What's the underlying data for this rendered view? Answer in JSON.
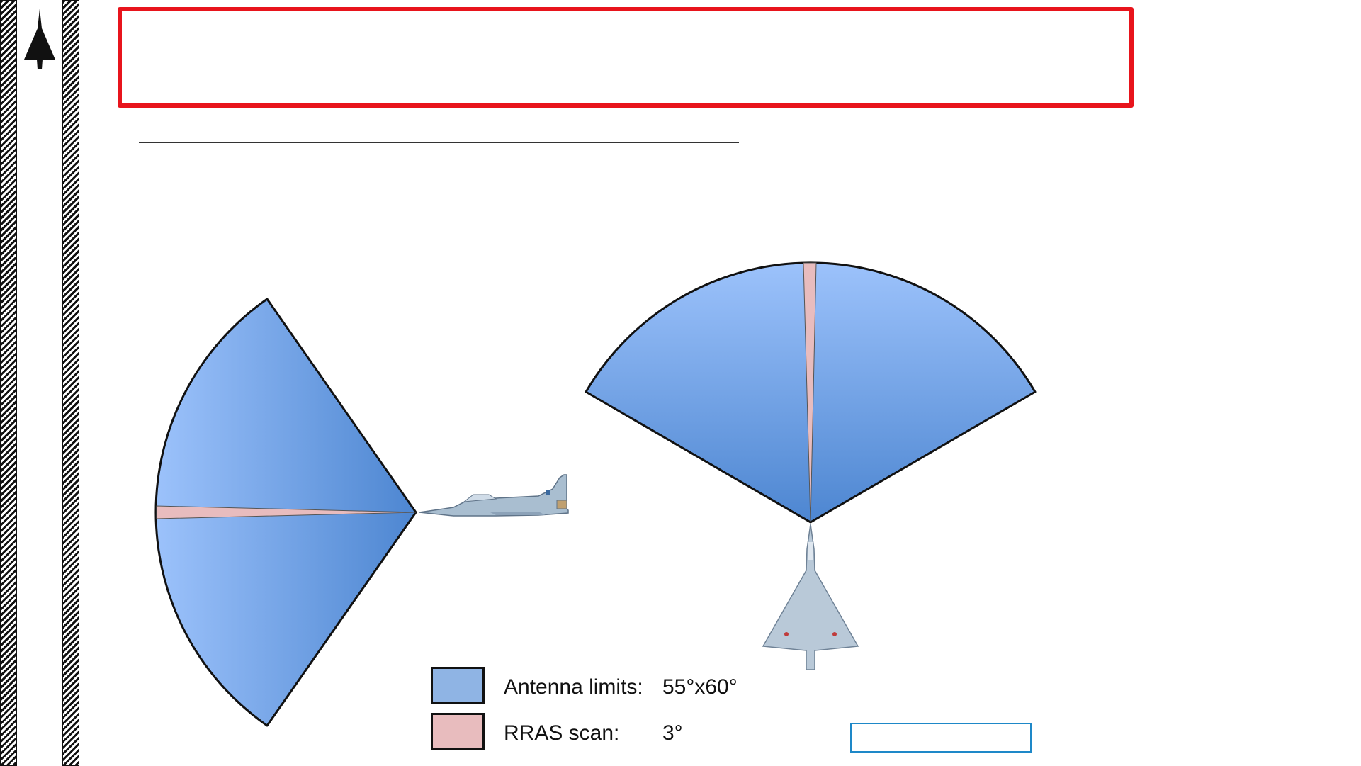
{
  "sidebar": {
    "icon": "delta-wing-jet-icon"
  },
  "legend": [
    {
      "label": "Antenna limits:",
      "value": "55°x60°",
      "color": "#8fb4e4"
    },
    {
      "label": "RRAS scan:",
      "value": "3°",
      "color": "#e8bcbe"
    }
  ],
  "colors": {
    "title_border": "#e8141c",
    "antenna_fill_light": "#9cc2fb",
    "antenna_fill_dark": "#4d86d1",
    "rras_fill": "#e8bcbe"
  },
  "views": [
    {
      "view": "side",
      "aircraft_icon": "jet-side-view-icon"
    },
    {
      "view": "top",
      "aircraft_icon": "jet-top-view-icon"
    }
  ]
}
